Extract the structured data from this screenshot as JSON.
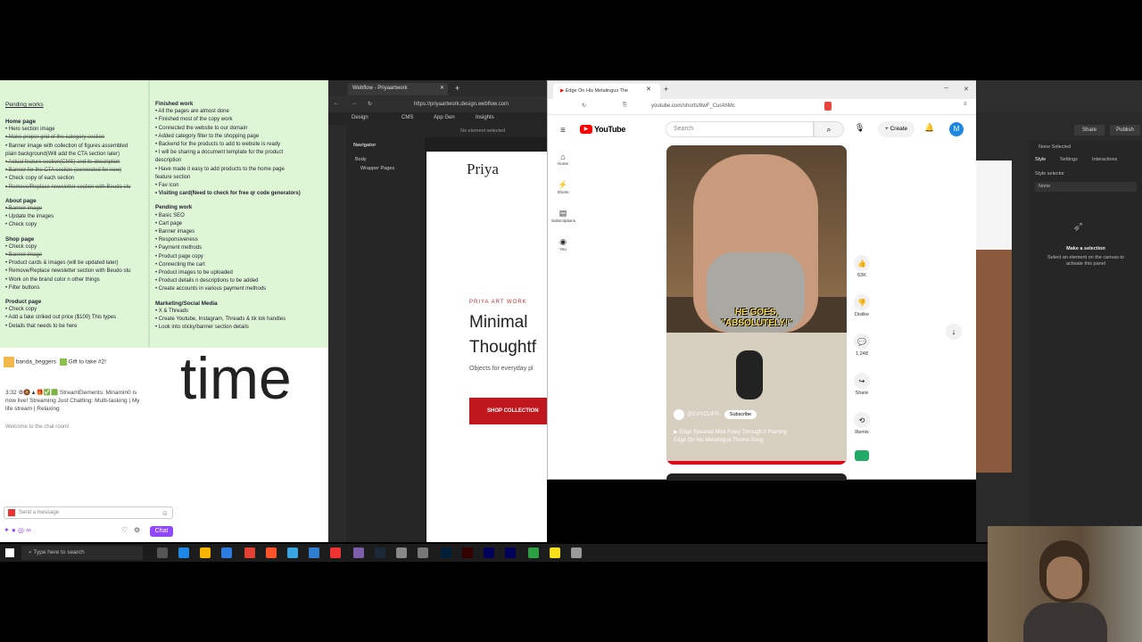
{
  "notes": {
    "title": "Pending works",
    "col1": [
      {
        "h": "Home page"
      },
      {
        "t": "• Hero section image"
      },
      {
        "t": "• Make proper grid of the category section",
        "s": true
      },
      {
        "t": "• Banner image with collection of figures assembled"
      },
      {
        "t": "plain background(Will add the CTA section later)"
      },
      {
        "t": "• Actual feature section(CMS) and its description",
        "s": true
      },
      {
        "t": "• Banner for the CTA section (connected for now)",
        "s": true
      },
      {
        "t": "• Check copy of each section"
      },
      {
        "t": "• Remove/Replace newsletter section with Beudo stu",
        "s": true
      },
      {
        "h": "About page"
      },
      {
        "t": "• Banner image",
        "s": true
      },
      {
        "t": "• Update the images"
      },
      {
        "t": "• Check copy"
      },
      {
        "h": "Shop page"
      },
      {
        "t": "• Check copy"
      },
      {
        "t": "• Banner image",
        "s": true
      },
      {
        "t": "• Product cards & images (will be updated later)"
      },
      {
        "t": "• Remove/Replace newsletter section with Beudo stu"
      },
      {
        "t": "• Work on the brand color n other things"
      },
      {
        "t": "• Filter buttons"
      },
      {
        "h": "Product page"
      },
      {
        "t": "• Check copy"
      },
      {
        "t": "• Add a fake striked out price ($100) This types"
      },
      {
        "t": "• Details that needs to be here"
      }
    ],
    "col2": [
      {
        "h": "Finished work"
      },
      {
        "t": "• All the pages are almost done"
      },
      {
        "t": "• Finished most of the copy work"
      },
      {
        "t": "• Connected the website to our domain"
      },
      {
        "t": "• Added category filter to the shopping page"
      },
      {
        "t": "• Backend for the products to add to website is ready"
      },
      {
        "t": "• I will be sharing a document template for the product"
      },
      {
        "t": "description"
      },
      {
        "t": "• Have made it easy to add products to the home page"
      },
      {
        "t": "feature section"
      },
      {
        "t": "• Fav icon"
      },
      {
        "t": "• Visiting card(Need to check for free qr code generators)",
        "b": true
      },
      {
        "h": "Pending work"
      },
      {
        "t": "• Basic SEO"
      },
      {
        "t": "• Cart page"
      },
      {
        "t": "• Banner images"
      },
      {
        "t": "• Responsiveness"
      },
      {
        "t": "• Payment methods"
      },
      {
        "t": "• Product page copy"
      },
      {
        "t": "• Connecting the cart"
      },
      {
        "t": "• Product images to be uploaded"
      },
      {
        "t": "• Product details n descriptions to be added"
      },
      {
        "t": "• Create accounts in various payment methods"
      },
      {
        "h": "Marketing/Social Media"
      },
      {
        "t": "• X & Threads"
      },
      {
        "t": "• Create Youtube, Instagram, Threads & tik tok handles"
      },
      {
        "t": "• Look into sticky/banner section details"
      }
    ]
  },
  "chat": {
    "user": "banda_beggers",
    "gift": "Gift to take #2!",
    "line1": "3:32 ⚙🔕▲🎁✅🟩 StreamElements: Minamin0 is",
    "line2": "now live! Streaming Just Chatting: Multi-tasking | My",
    "line3": "life stream | Relaxing",
    "welcome": "Welcome to the chat room!",
    "placeholder": "Send a message",
    "chat_button": "Chat",
    "big_text": "time"
  },
  "webflow": {
    "tab_title": "Webflow - Priyaartwork",
    "url": "https://priyaartwork.design.webflow.com",
    "design": "Design",
    "cms": "CMS",
    "app_gen": "App Gen",
    "insights": "Insights",
    "navigator": "Navigator",
    "no_element": "No element selected",
    "body": "Body",
    "wrapper": "Wrapper Pages",
    "logo": "Priya",
    "eyebrow": "PRIYA ART WORK",
    "headline1": "Minimal",
    "headline2": "Thoughtf",
    "sub": "Objects for everyday pl",
    "cta": "SHOP COLLECTION"
  },
  "youtube": {
    "tab_title": "Edge On His Metalingus The",
    "url": "youtube.com/shorts/8wF_CurAhMc",
    "brand": "YouTube",
    "search_placeholder": "Search",
    "create": "Create",
    "avatar": "M",
    "side": [
      "Home",
      "Shorts",
      "Subscriptions",
      "You"
    ],
    "caption1": "HE GOES,",
    "caption2": "\"ABSOLUTELY!\"",
    "channel": "@CVVCLIPS",
    "subscribe": "Subscribe",
    "title1": "▶ Edge Speared Mick Foley Through A Flaming",
    "title2": "Edge On His Metalingus Theme Song",
    "likes": "63K",
    "dislike": "Dislike",
    "comments": "1,248",
    "share": "Share",
    "remix": "Remix"
  },
  "wf_right": {
    "none_selected": "None Selected",
    "style": "Style",
    "settings": "Settings",
    "interactions": "Interactions",
    "style_selector": "Style selector",
    "none": "None",
    "make_selection": "Make a selection",
    "select_hint": "Select an element on the canvas to activate this panel",
    "share": "Share",
    "publish": "Publish"
  },
  "taskbar": {
    "search_placeholder": "Type here to search"
  },
  "colors": {
    "notes_bg": "#dff6d6",
    "yt_red": "#ff0000",
    "wf_cta": "#c0161e",
    "twitch_purple": "#9146ff"
  }
}
